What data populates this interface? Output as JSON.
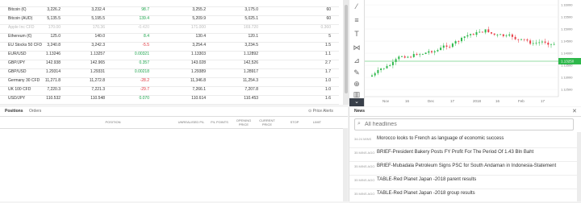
{
  "watchlist": {
    "rows": [
      {
        "name": "",
        "bid": "",
        "ask": "",
        "change": "",
        "change_dir": "",
        "high": "",
        "low": "",
        "spread": "",
        "dim": false
      },
      {
        "name": "Bitcoin (€)",
        "bid": "3,226.2",
        "ask": "3,232.4",
        "change": "98.7",
        "change_dir": "pos",
        "high": "3,255.2",
        "low": "3,175.0",
        "spread": "60",
        "dim": false
      },
      {
        "name": "Bitcoin (AUD)",
        "bid": "5,135.5",
        "ask": "5,195.5",
        "change": "139.4",
        "change_dir": "pos",
        "high": "5,209.9",
        "low": "5,025.1",
        "spread": "60",
        "dim": false
      },
      {
        "name": "Apple Inc CFD",
        "bid": "170.00",
        "ask": "170.36",
        "change": "-0.420",
        "change_dir": "dim",
        "high": "171.000",
        "low": "169.720",
        "spread": "0.360",
        "dim": true
      },
      {
        "name": "Ethereum (€)",
        "bid": "125.0",
        "ask": "140.0",
        "change": "8.4",
        "change_dir": "pos",
        "high": "130.4",
        "low": "120.1",
        "spread": "5",
        "dim": false
      },
      {
        "name": "EU Stocks 50 CFD",
        "bid": "3,240.8",
        "ask": "3,242.3",
        "change": "-5.5",
        "change_dir": "neg",
        "high": "3,254.4",
        "low": "3,234.5",
        "spread": "1.5",
        "dim": false
      },
      {
        "name": "EUR/USD",
        "bid": "1.13246",
        "ask": "1.13257",
        "change": "0.00321",
        "change_dir": "pos",
        "high": "1.13303",
        "low": "1.12892",
        "spread": "1.1",
        "dim": false
      },
      {
        "name": "GBP/JPY",
        "bid": "142.938",
        "ask": "142.965",
        "change": "0.357",
        "change_dir": "pos",
        "high": "143.028",
        "low": "142,526",
        "spread": "2.7",
        "dim": false
      },
      {
        "name": "GBP/USD",
        "bid": "1.29314",
        "ask": "1.29331",
        "change": "0.00218",
        "change_dir": "pos",
        "high": "1.29389",
        "low": "1.28917",
        "spread": "1.7",
        "dim": false
      },
      {
        "name": "Germany 30 CFD",
        "bid": "11,271.8",
        "ask": "11,272.8",
        "change": "-28.2",
        "change_dir": "neg",
        "high": "11,346.8",
        "low": "11,254.3",
        "spread": "1.0",
        "dim": false
      },
      {
        "name": "UK 100 CFD",
        "bid": "7,220.3",
        "ask": "7,221.3",
        "change": "-29.7",
        "change_dir": "neg",
        "high": "7,266.1",
        "low": "7,207.8",
        "spread": "1.0",
        "dim": false
      },
      {
        "name": "USD/JPY",
        "bid": "110.532",
        "ask": "110.548",
        "change": "0.070",
        "change_dir": "pos",
        "high": "110.614",
        "low": "110.453",
        "spread": "1.6",
        "dim": false
      }
    ]
  },
  "chart": {
    "x_ticks": [
      "Nov",
      "16",
      "Dec",
      "17",
      "2018",
      "16",
      "Feb",
      "17"
    ],
    "y_ticks": [
      "1.16000",
      "1.15500",
      "1.15000",
      "1.14500",
      "1.14000",
      "1.13500",
      "1.13000",
      "1.12500"
    ],
    "price_tag": "1.13250",
    "colors": {
      "up": "#2eb84b",
      "down": "#e8414a",
      "tag": "#2eb84b"
    }
  },
  "positions": {
    "tabs": [
      "Positions",
      "Orders"
    ],
    "price_alerts": "Price Alerts",
    "columns": [
      "POSITION",
      "UNREALISED P/L",
      "P/L POINTS",
      "OPENING PRICE",
      "CURRENT PRICE",
      "STOP",
      "LIMIT"
    ]
  },
  "news": {
    "title": "News",
    "search_placeholder": "All headlines",
    "items": [
      {
        "time": "34:24 MINS",
        "title": "Morocco looks to French as language of economic success"
      },
      {
        "time": "35 MINS AGO",
        "title": "BRIEF-President Bakery Posts FY Profit For The Period Of 1.43 Bln Baht"
      },
      {
        "time": "35 MINS AGO",
        "title": "BRIEF-Mubadala Petroleum Signs PSC for South Andaman in Indonesia-Statement"
      },
      {
        "time": "35 MINS AGO",
        "title": "TABLE-Red Planet Japan -2018 parent results"
      },
      {
        "time": "35 MINS AGO",
        "title": "TABLE-Red Planet Japan -2018 group results"
      }
    ]
  },
  "icons": [
    "tool-icons",
    "zoom-icon",
    "scroll-icon",
    "close-icon",
    "search-icon",
    "alert-icon"
  ]
}
